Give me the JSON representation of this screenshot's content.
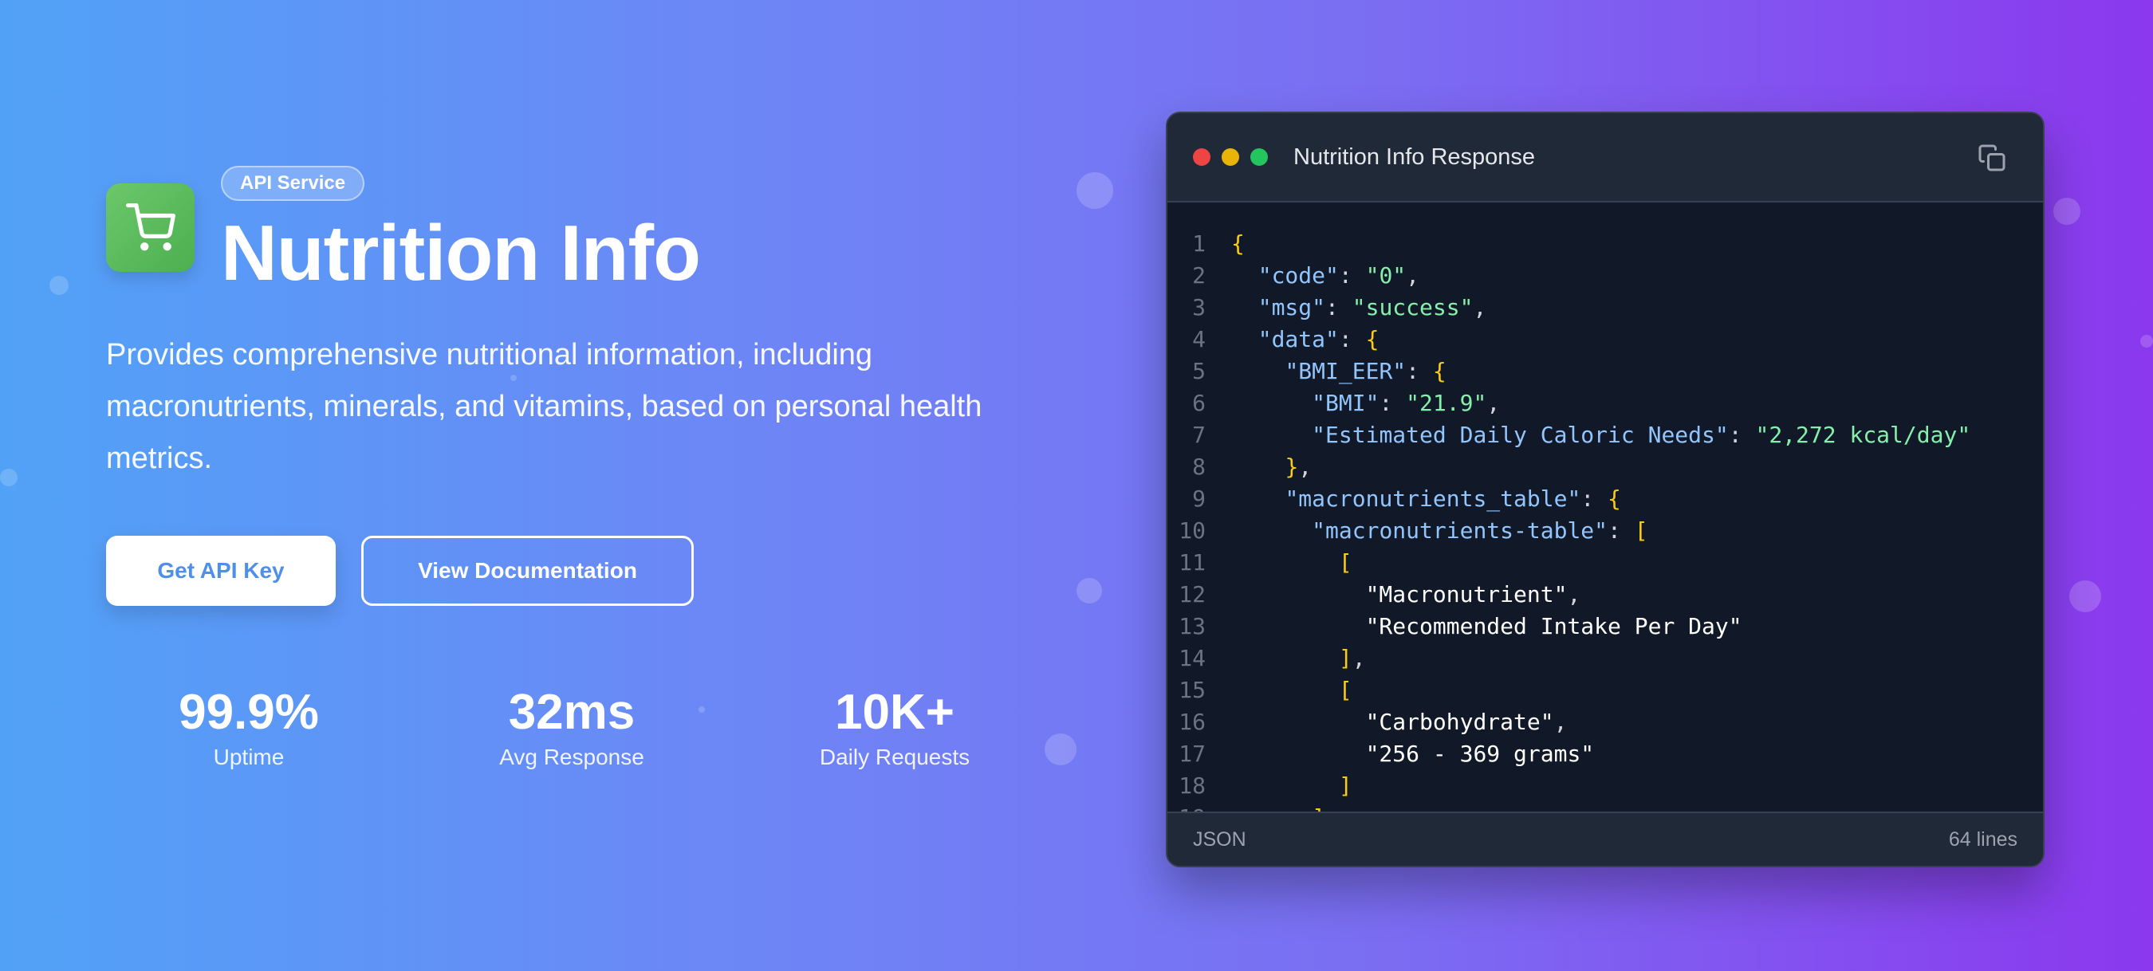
{
  "hero": {
    "badge": "API Service",
    "title": "Nutrition Info",
    "description": "Provides comprehensive nutritional information, including macronutrients, minerals, and vitamins, based on personal health metrics.",
    "icon": "shopping-cart-icon",
    "icon_bg": "#5cbf5e",
    "primary_button": "Get API Key",
    "secondary_button": "View Documentation",
    "stats": [
      {
        "value": "99.9%",
        "label": "Uptime"
      },
      {
        "value": "32ms",
        "label": "Avg Response"
      },
      {
        "value": "10K+",
        "label": "Daily Requests"
      }
    ]
  },
  "code_window": {
    "title": "Nutrition Info Response",
    "language": "JSON",
    "line_count": "64 lines",
    "lines": [
      "{",
      "  \"code\": \"0\",",
      "  \"msg\": \"success\",",
      "  \"data\": {",
      "    \"BMI_EER\": {",
      "      \"BMI\": \"21.9\",",
      "      \"Estimated Daily Caloric Needs\": \"2,272 kcal/day\"",
      "    },",
      "    \"macronutrients_table\": {",
      "      \"macronutrients-table\": [",
      "        [",
      "          \"Macronutrient\",",
      "          \"Recommended Intake Per Day\"",
      "        ],",
      "        [",
      "          \"Carbohydrate\",",
      "          \"256 - 369 grams\"",
      "        ]",
      "      ],"
    ]
  },
  "colors": {
    "gradient_start": "#51a2f7",
    "gradient_end": "#8b38ee",
    "primary_button_text": "#4f8fe8",
    "code_bg": "#111827"
  }
}
